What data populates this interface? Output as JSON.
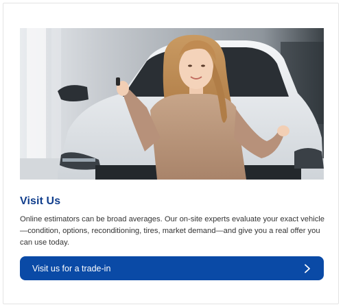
{
  "card": {
    "image_icon": "hero-photo",
    "title": "Visit Us",
    "body": "Online estimators can be broad averages. Our on-site experts evaluate your exact vehicle—condition, options, reconditioning, tires, market demand—and give you a real offer you can use today.",
    "cta_label": "Visit us for a trade-in",
    "cta_icon": "chevron-right-icon"
  },
  "colors": {
    "title": "#0f3d8c",
    "cta_background": "#0a4aa6",
    "cta_text": "#ffffff",
    "body_text": "#333333"
  }
}
